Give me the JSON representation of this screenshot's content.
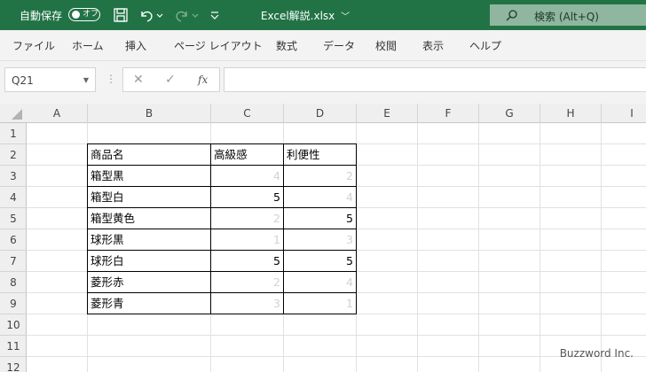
{
  "titlebar": {
    "autosave_label": "自動保存",
    "autosave_state": "オフ",
    "document_title": "Excel解説.xlsx",
    "search_label": "検索 (Alt+Q)"
  },
  "ribbon": {
    "tabs": [
      "ファイル",
      "ホーム",
      "挿入",
      "ページ レイアウト",
      "数式",
      "データ",
      "校閲",
      "表示",
      "ヘルプ"
    ]
  },
  "formula_bar": {
    "name_box": "Q21",
    "fx_label": "fx",
    "formula": ""
  },
  "sheet": {
    "columns": [
      "A",
      "B",
      "C",
      "D",
      "E",
      "F",
      "G",
      "H",
      "I"
    ],
    "rows": [
      "1",
      "2",
      "3",
      "4",
      "5",
      "6",
      "7",
      "8",
      "9",
      "10",
      "11",
      "12"
    ],
    "table": {
      "headers": [
        "商品名",
        "高級感",
        "利便性"
      ],
      "rows": [
        {
          "name": "箱型黒",
          "c": "4",
          "d": "2"
        },
        {
          "name": "箱型白",
          "c": "5",
          "d": "4"
        },
        {
          "name": "箱型黄色",
          "c": "2",
          "d": "5"
        },
        {
          "name": "球形黒",
          "c": "1",
          "d": "3"
        },
        {
          "name": "球形白",
          "c": "5",
          "d": "5"
        },
        {
          "name": "菱形赤",
          "c": "2",
          "d": "4"
        },
        {
          "name": "菱形青",
          "c": "3",
          "d": "1"
        }
      ]
    }
  },
  "watermark": "Buzzword Inc.",
  "colors": {
    "title_bar": "#217346",
    "faint_value": "#d2d2d2"
  }
}
